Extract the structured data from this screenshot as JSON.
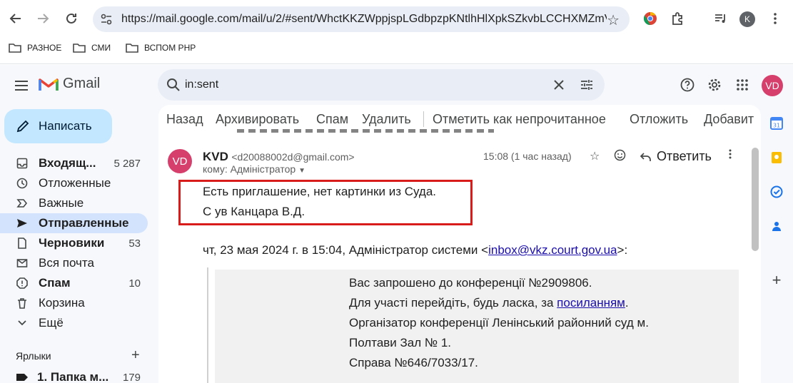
{
  "browser": {
    "url": "https://mail.google.com/mail/u/2/#sent/WhctKKZWppjspLGdbpzpKNtlhHlXpkSZkvbLCCHXMZmV...",
    "profile_initial": "K",
    "bookmarks": [
      {
        "label": "РАЗНОЕ"
      },
      {
        "label": "СМИ"
      },
      {
        "label": "ВСПОМ PHP"
      }
    ]
  },
  "gmail": {
    "logo_text": "Gmail",
    "search_value": "in:sent",
    "avatar_initials": "VD",
    "compose_label": "Написать",
    "nav": [
      {
        "label": "Входящ...",
        "count": "5 287",
        "icon": "inbox-icon"
      },
      {
        "label": "Отложенные",
        "count": "",
        "icon": "clock-icon"
      },
      {
        "label": "Важные",
        "count": "",
        "icon": "important-icon"
      },
      {
        "label": "Отправленные",
        "count": "",
        "icon": "send-icon"
      },
      {
        "label": "Черновики",
        "count": "53",
        "icon": "draft-icon"
      },
      {
        "label": "Вся почта",
        "count": "",
        "icon": "all-mail-icon"
      },
      {
        "label": "Спам",
        "count": "10",
        "icon": "spam-icon"
      },
      {
        "label": "Корзина",
        "count": "",
        "icon": "trash-icon"
      },
      {
        "label": "Ещё",
        "count": "",
        "icon": "chevron-down-icon"
      }
    ],
    "labels_header": "Ярлыки",
    "labels": [
      {
        "label": "1. Папка м...",
        "count": "179"
      }
    ],
    "toolbar": {
      "back": "Назад",
      "archive": "Архивировать",
      "spam": "Спам",
      "delete": "Удалить",
      "mark_unread": "Отметить как непрочитанное",
      "snooze": "Отложить",
      "add": "Добавит"
    },
    "message": {
      "avatar_initials": "VD",
      "sender_name": "KVD",
      "sender_email": "<d20088002d@gmail.com>",
      "to_line": "кому: Адміністратор",
      "time": "15:08 (1 час назад)",
      "reply_label": "Ответить",
      "body_lines": [
        "Есть приглашение, нет картинки из Суда.",
        "С ув Канцара В.Д."
      ],
      "quote_header_prefix": "чт, 23 мая 2024 г. в 15:04, Адміністратор системи <",
      "quote_header_link": "inbox@vkz.court.gov.ua",
      "quote_header_suffix": ">:",
      "quote_lines": [
        {
          "text": "Вас запрошено до конференції №2909806.",
          "link": "",
          "after": ""
        },
        {
          "text": "Для участі перейдіть, будь ласка, за ",
          "link": "посиланням",
          "after": "."
        },
        {
          "text": "Організатор конференції Ленінський районний суд м.",
          "link": "",
          "after": ""
        },
        {
          "text": "Полтави Зал № 1.",
          "link": "",
          "after": ""
        },
        {
          "text": "Справа №646/7033/17.",
          "link": "",
          "after": ""
        }
      ]
    }
  },
  "colors": {
    "accent": "#c2e7ff",
    "active_nav": "#d3e3fd",
    "highlight_border": "#d81b1b",
    "avatar": "#d63f6c",
    "link": "#1a0dab"
  }
}
